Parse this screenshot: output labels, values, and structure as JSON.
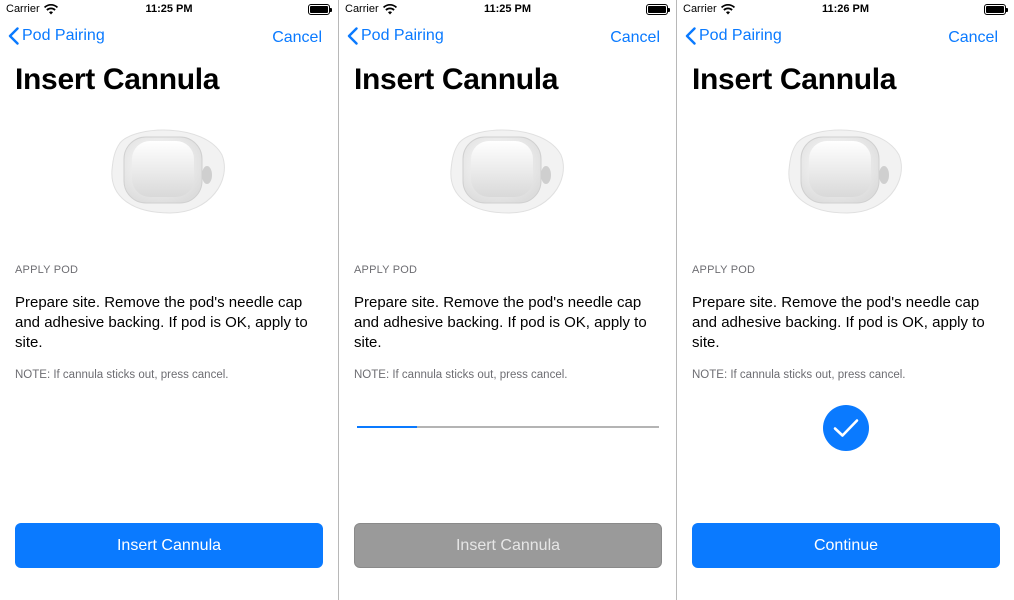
{
  "status_bar": {
    "carrier": "Carrier",
    "times": [
      "11:25 PM",
      "11:25 PM",
      "11:26 PM"
    ]
  },
  "nav": {
    "back_label": "Pod Pairing",
    "cancel_label": "Cancel"
  },
  "title": "Insert Cannula",
  "section_header": "APPLY POD",
  "instructions": "Prepare site. Remove the pod's needle cap and adhesive backing. If pod is OK, apply to site.",
  "note": "NOTE: If cannula sticks out, press cancel.",
  "progress": {
    "value": 0.2
  },
  "buttons": {
    "insert_cannula": "Insert Cannula",
    "continue": "Continue"
  },
  "colors": {
    "accent": "#0a7aff",
    "disabled_button": "#9a9a9a",
    "secondary_text": "#6d6d72"
  },
  "icons": [
    "wifi-icon",
    "battery-icon",
    "chevron-left-icon",
    "pod-image",
    "checkmark-icon"
  ]
}
